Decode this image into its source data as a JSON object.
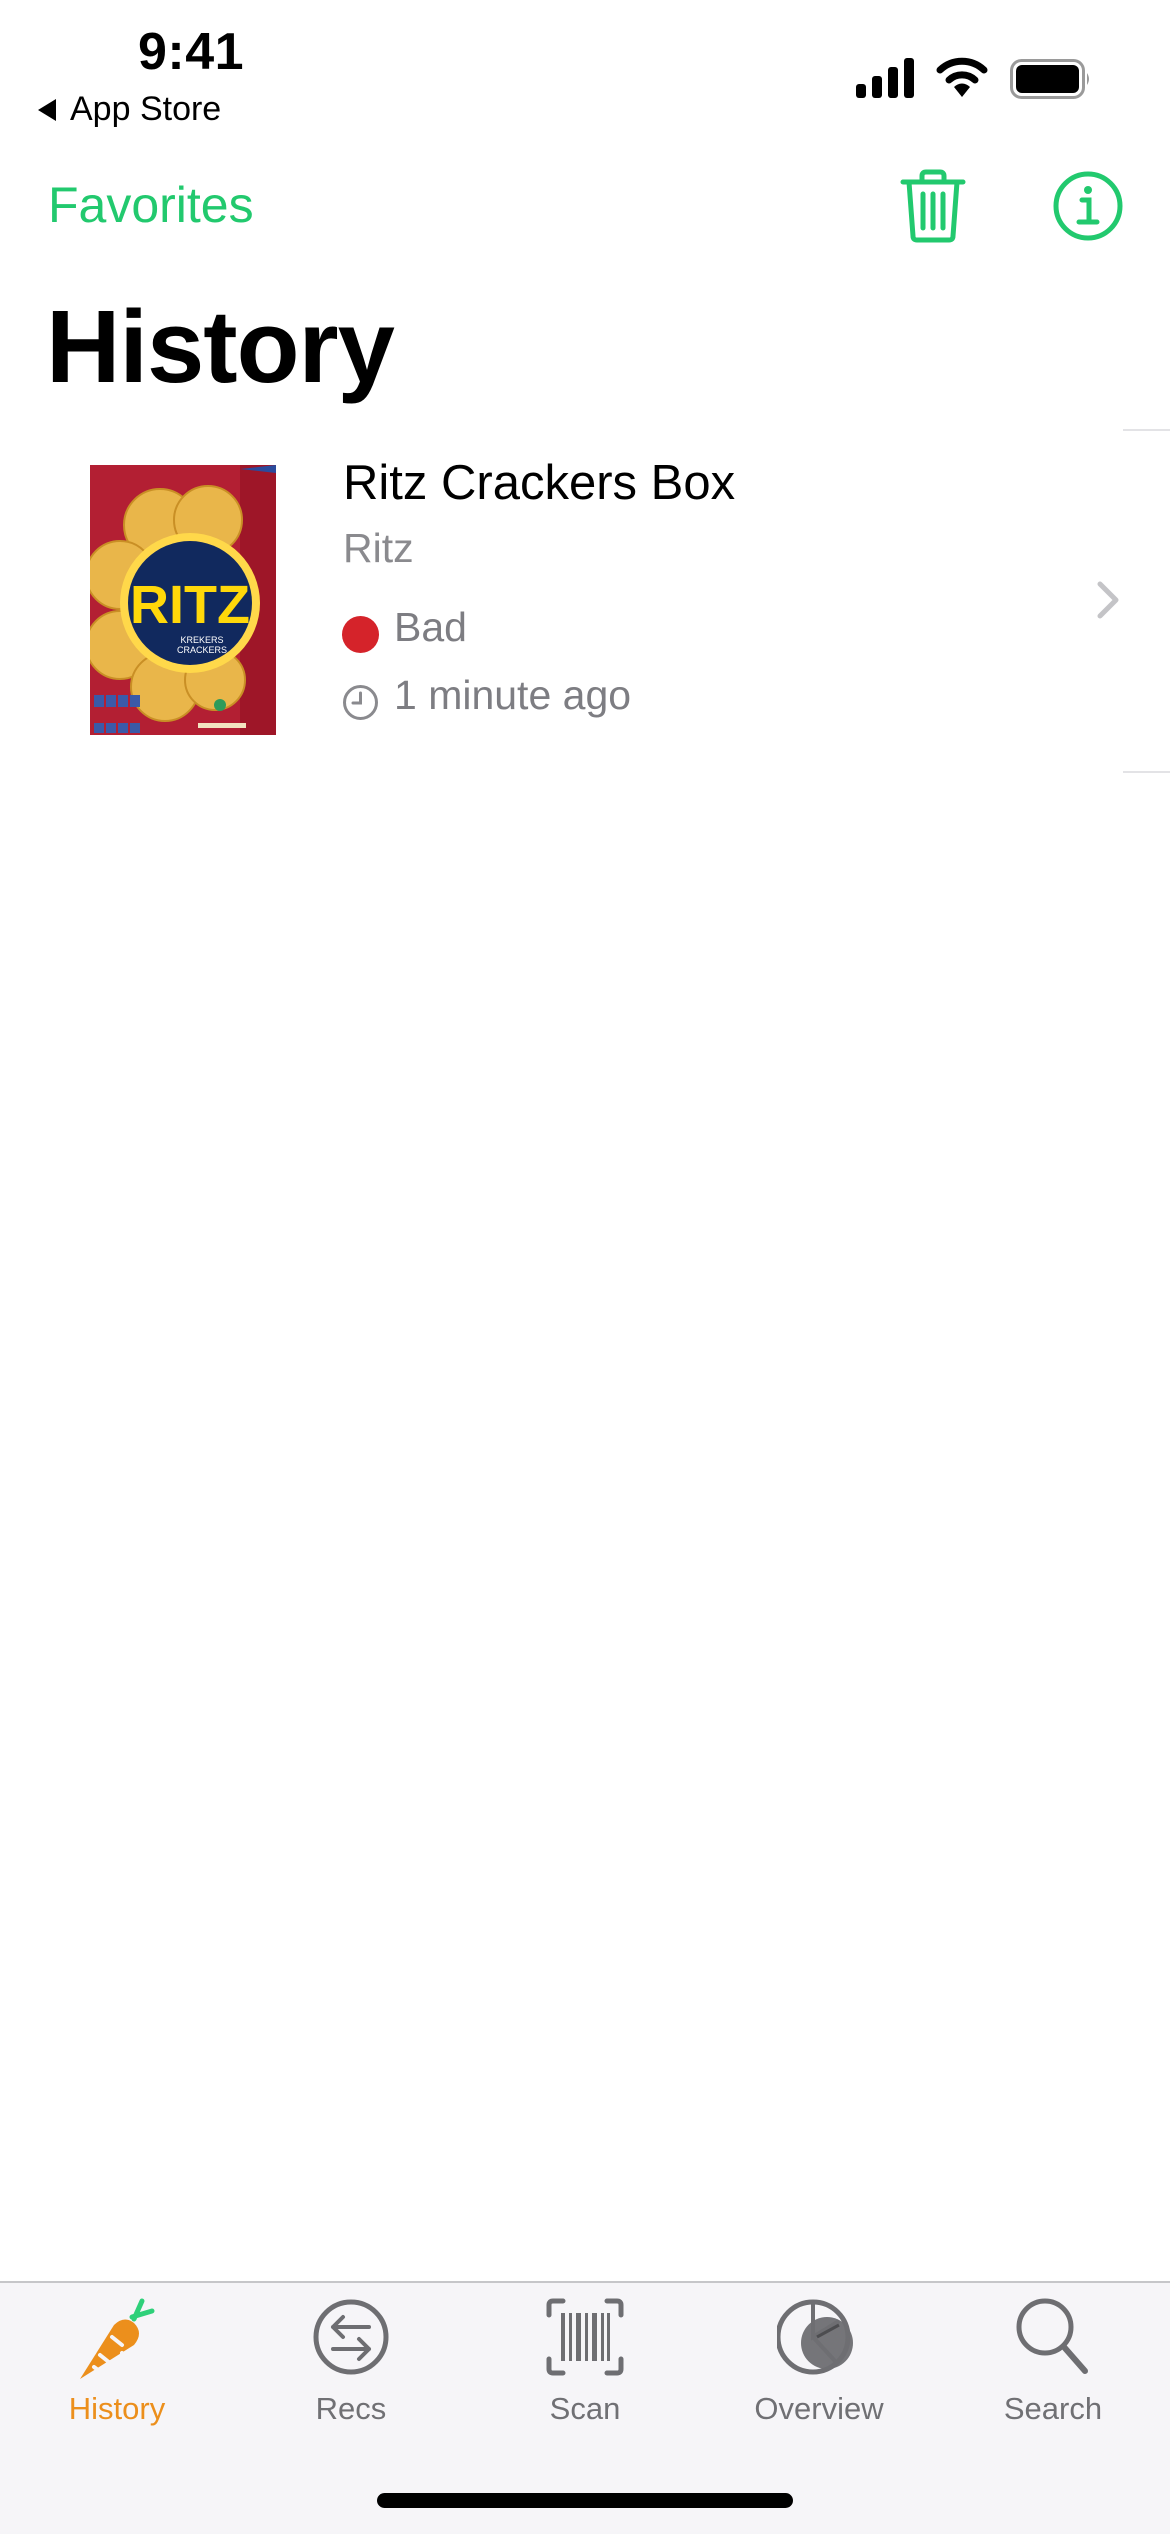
{
  "status_bar": {
    "time": "9:41",
    "back_label": "App Store",
    "icons": [
      "cellular-signal-icon",
      "wifi-icon",
      "battery-icon"
    ]
  },
  "nav": {
    "left_button": "Favorites",
    "right_icons": [
      "trash-icon",
      "info-icon"
    ],
    "accent_color": "#22c96e"
  },
  "page": {
    "title": "History"
  },
  "history_items": [
    {
      "title": "Ritz Crackers Box",
      "brand": "Ritz",
      "rating": "Bad",
      "rating_color": "#d5232a",
      "time_ago": "1 minute ago",
      "thumbnail": {
        "logo_text": "RITZ",
        "sub_text_1": "KREKERS",
        "sub_text_2": "CRACKERS"
      }
    }
  ],
  "tab_bar": {
    "active_color": "#ec8f1c",
    "tabs": [
      {
        "label": "History",
        "icon": "carrot-icon",
        "active": true
      },
      {
        "label": "Recs",
        "icon": "swap-arrows-icon",
        "active": false
      },
      {
        "label": "Scan",
        "icon": "barcode-scan-icon",
        "active": false
      },
      {
        "label": "Overview",
        "icon": "pie-chart-icon",
        "active": false
      },
      {
        "label": "Search",
        "icon": "magnifying-glass-icon",
        "active": false
      }
    ]
  }
}
